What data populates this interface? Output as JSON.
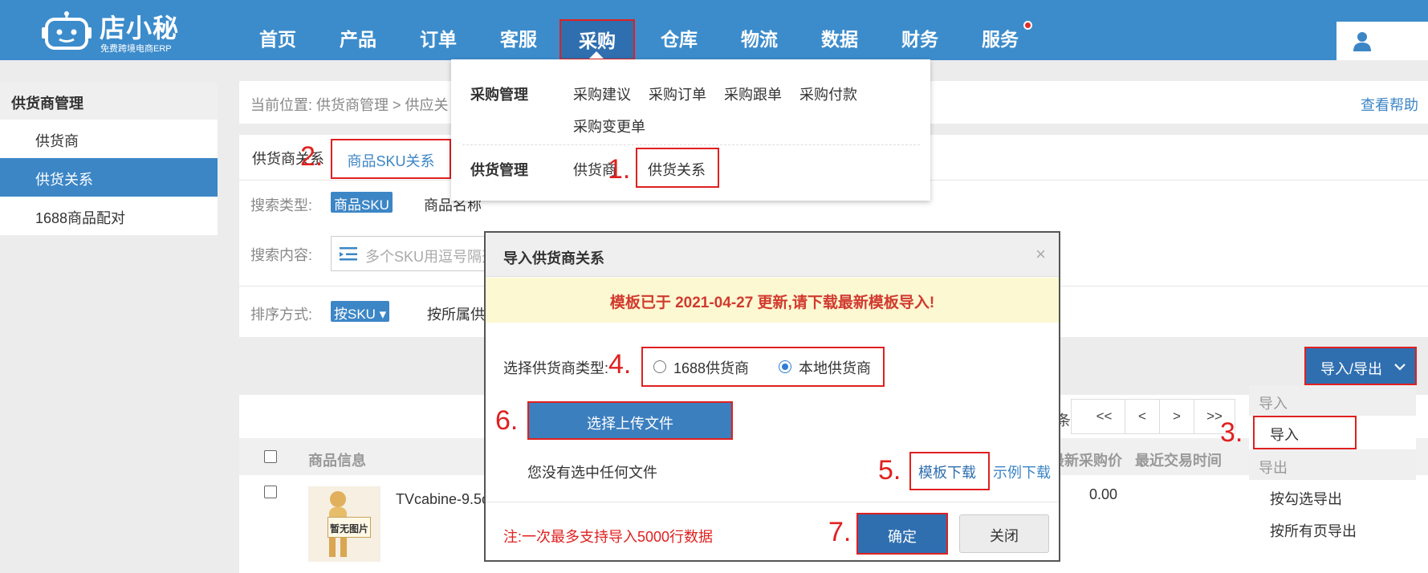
{
  "header": {
    "logo_name": "店小秘",
    "logo_sub": "免费跨境电商ERP",
    "nav": [
      "首页",
      "产品",
      "订单",
      "客服",
      "采购",
      "仓库",
      "物流",
      "数据",
      "财务",
      "服务"
    ],
    "active_nav": "采购"
  },
  "purchase_menu": {
    "group1_label": "采购管理",
    "group1_items": [
      "采购建议",
      "采购订单",
      "采购跟单",
      "采购付款",
      "采购变更单"
    ],
    "group2_label": "供货管理",
    "group2_items": [
      "供货商",
      "供货关系"
    ]
  },
  "sidebar": {
    "heading": "供货商管理",
    "items": [
      {
        "label": "供货商",
        "active": false
      },
      {
        "label": "供货关系",
        "active": true
      },
      {
        "label": "1688商品配对",
        "active": false
      }
    ]
  },
  "breadcrumb": {
    "text": "当前位置:   供货商管理 > 供应关",
    "help": "查看帮助"
  },
  "tabs": {
    "first": "供货商关系",
    "active": "商品SKU关系"
  },
  "filters": {
    "search_type_label": "搜索类型:",
    "search_type_active": "商品SKU",
    "search_type_other": "商品名称",
    "search_content_label": "搜索内容:",
    "search_placeholder": "多个SKU用逗号隔开",
    "sort_label": "排序方式:",
    "sort_active": "按SKU ▾",
    "sort_other": "按所属供"
  },
  "table": {
    "pager_suffix": "条",
    "pager": [
      "<<",
      "<",
      ">",
      ">>"
    ],
    "headers": {
      "product_info": "商品信息",
      "latest_price": "最新采购价",
      "last_trade": "最近交易时间"
    },
    "rows": [
      {
        "no_image": "暂无图片",
        "name": "TVcabine-9.5c",
        "price": "0.00"
      }
    ]
  },
  "import_export": {
    "button": "导入/导出",
    "import_group": "导入",
    "import_item": "导入",
    "export_group": "导出",
    "export_items": [
      "按勾选导出",
      "按所有页导出"
    ]
  },
  "modal": {
    "title": "导入供货商关系",
    "close": "×",
    "notice": "模板已于 2021-04-27 更新,请下载最新模板导入!",
    "supplier_type_label": "选择供货商类型:",
    "options": [
      {
        "label": "1688供货商",
        "selected": false
      },
      {
        "label": "本地供货商",
        "selected": true
      }
    ],
    "upload_button": "选择上传文件",
    "no_file_text": "您没有选中任何文件",
    "template_download": "模板下载",
    "sample_download": "示例下载",
    "note": "注:一次最多支持导入5000行数据",
    "confirm": "确定",
    "cancel": "关闭"
  },
  "steps": [
    "1.",
    "2.",
    "3.",
    "4.",
    "5.",
    "6.",
    "7."
  ],
  "colors": {
    "header_bg": "#3c8ccc",
    "accent": "#2f6fb0",
    "annotation_red": "#e02020",
    "notice_bg": "#fcf8d2",
    "notice_text": "#d13a2f"
  }
}
